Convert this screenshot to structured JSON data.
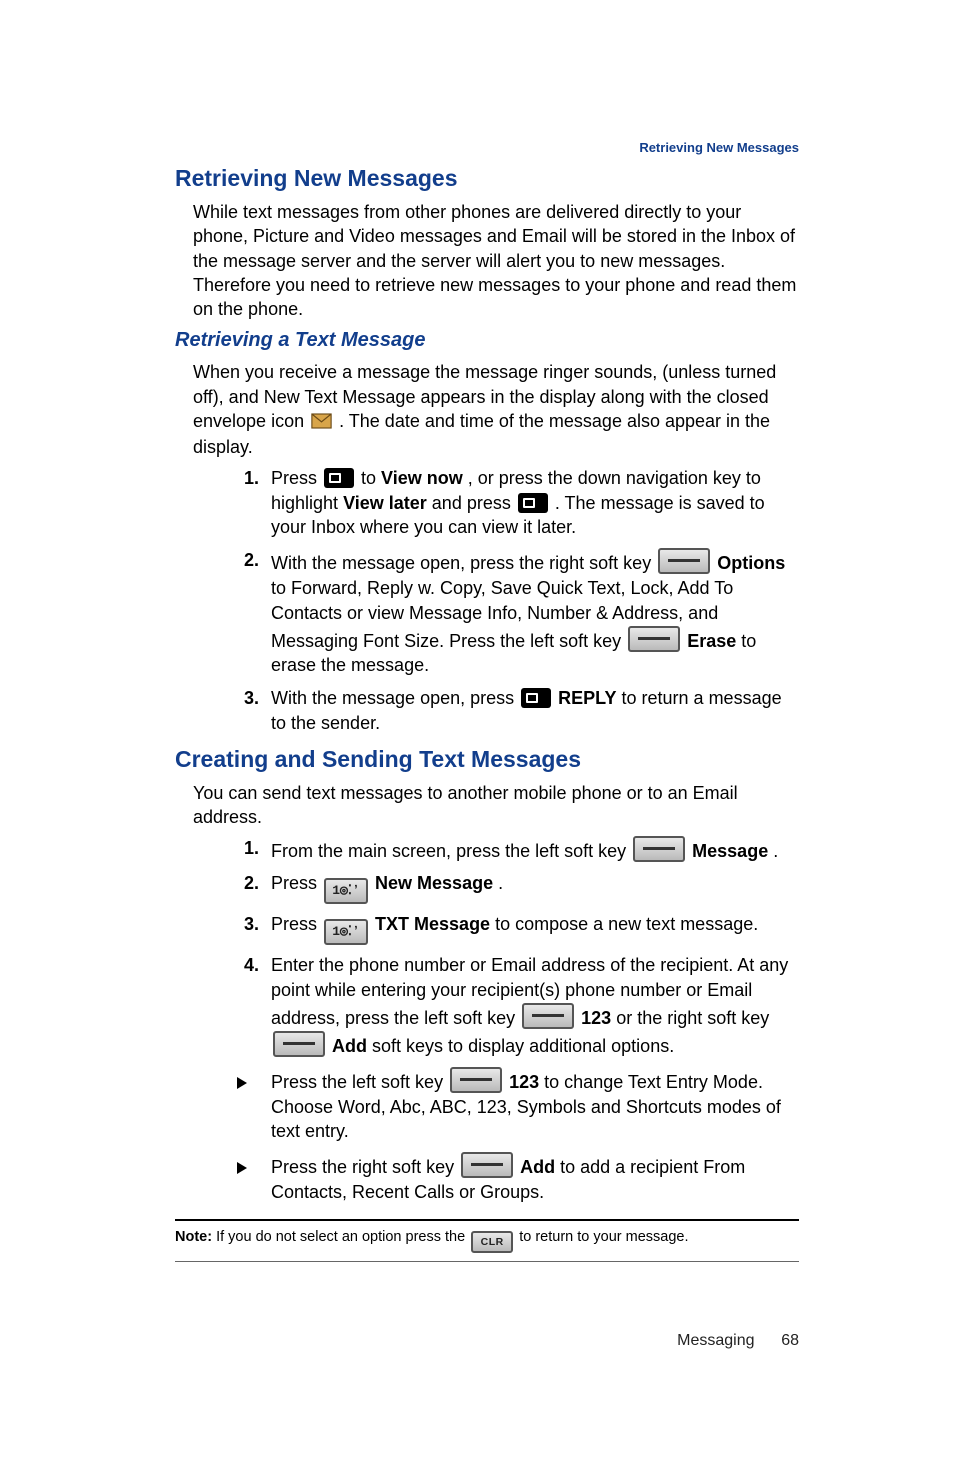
{
  "running_head": "Retrieving New Messages",
  "s1": {
    "title": "Retrieving New Messages",
    "p1": "While text messages from other phones are delivered directly to your phone, Picture and Video messages and Email will be stored in the Inbox of the message server and the server will alert you to new messages. Therefore you need to retrieve new messages to your phone and read them on the phone."
  },
  "s2": {
    "title": "Retrieving a Text Message",
    "p1a": "When you receive a message the message ringer sounds, (unless turned off), and New Text Message appears in the display along with the closed envelope icon ",
    "p1b": " . The date and time of the message also appear in the display.",
    "steps": [
      {
        "num": "1.",
        "a": "Press ",
        "b": " to ",
        "vn": "View now",
        "c": ", or press the down navigation key to highlight ",
        "vl": "View later",
        "d": " and press ",
        "e": " . The message is saved to your Inbox where you can view it later."
      },
      {
        "num": "2.",
        "a": "With the message open, press the right soft key ",
        "opt": "Options",
        "b": " to Forward, Reply w. Copy, Save Quick Text, Lock, Add To Contacts or view Message Info, Number & Address, and Messaging Font Size. Press the left soft key ",
        "erase": "Erase",
        "c": " to erase the message."
      },
      {
        "num": "3.",
        "a": "With the message open, press ",
        "reply": "REPLY",
        "b": " to return a message to the sender."
      }
    ]
  },
  "s3": {
    "title": "Creating and Sending Text Messages",
    "p1": "You can send text messages to another mobile phone or to an Email address.",
    "steps": [
      {
        "num": "1.",
        "a": "From the main screen, press the left soft key ",
        "msg": "Message",
        "b": "."
      },
      {
        "num": "2.",
        "a": "Press ",
        "onekey": "1",
        "nm": "New Message",
        "b": "."
      },
      {
        "num": "3.",
        "a": "Press ",
        "onekey": "1",
        "txt": "TXT Message",
        "b": " to compose a new text message."
      },
      {
        "num": "4.",
        "a": "Enter the phone number or Email address of the recipient. At any point while entering your recipient(s) phone number or Email address, press the left soft key ",
        "k123": "123",
        "b": " or the right soft key ",
        "add": "Add",
        "c": " soft keys to display additional options."
      }
    ],
    "bullets": [
      {
        "a": "Press the left soft key ",
        "k123": "123",
        "b": " to change Text Entry Mode. Choose Word, Abc, ABC, 123, Symbols and Shortcuts modes of text entry."
      },
      {
        "a": "Press the right soft key ",
        "add": "Add",
        "b": " to add a recipient From Contacts, Recent Calls or Groups."
      }
    ]
  },
  "note": {
    "label": "Note:",
    "a": " If you do not select an option press the ",
    "clr": "CLR",
    "b": " to return to your message."
  },
  "footer": {
    "section": "Messaging",
    "page": "68"
  }
}
